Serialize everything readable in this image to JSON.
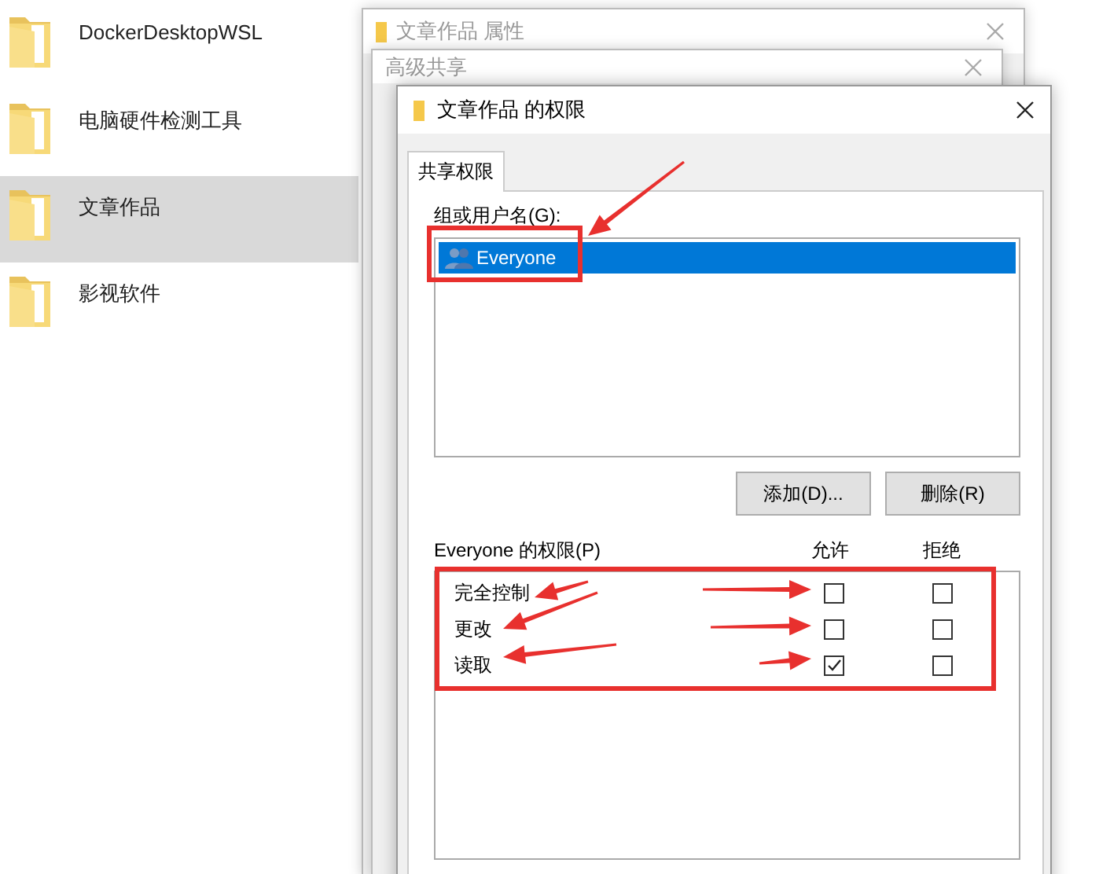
{
  "explorer": {
    "items": [
      {
        "name": "DockerDesktopWSL",
        "selected": false
      },
      {
        "name": "电脑硬件检测工具",
        "selected": false
      },
      {
        "name": "文章作品",
        "selected": true
      },
      {
        "name": "影视软件",
        "selected": false
      }
    ]
  },
  "properties_window": {
    "title": "文章作品 属性"
  },
  "advanced_sharing_window": {
    "title": "高级共享"
  },
  "permissions_dialog": {
    "title": "文章作品 的权限",
    "tabs": [
      {
        "label": "共享权限",
        "selected": true
      }
    ],
    "group_label": "组或用户名(G):",
    "groups": [
      {
        "name": "Everyone",
        "selected": true
      }
    ],
    "buttons": [
      "添加(D)...",
      "删除(R)"
    ],
    "permissions_label": "Everyone 的权限(P)",
    "columns": [
      "允许",
      "拒绝"
    ],
    "permissions": [
      {
        "name": "完全控制",
        "allow": false,
        "deny": false
      },
      {
        "name": "更改",
        "allow": false,
        "deny": false
      },
      {
        "name": "读取",
        "allow": true,
        "deny": false
      }
    ]
  }
}
